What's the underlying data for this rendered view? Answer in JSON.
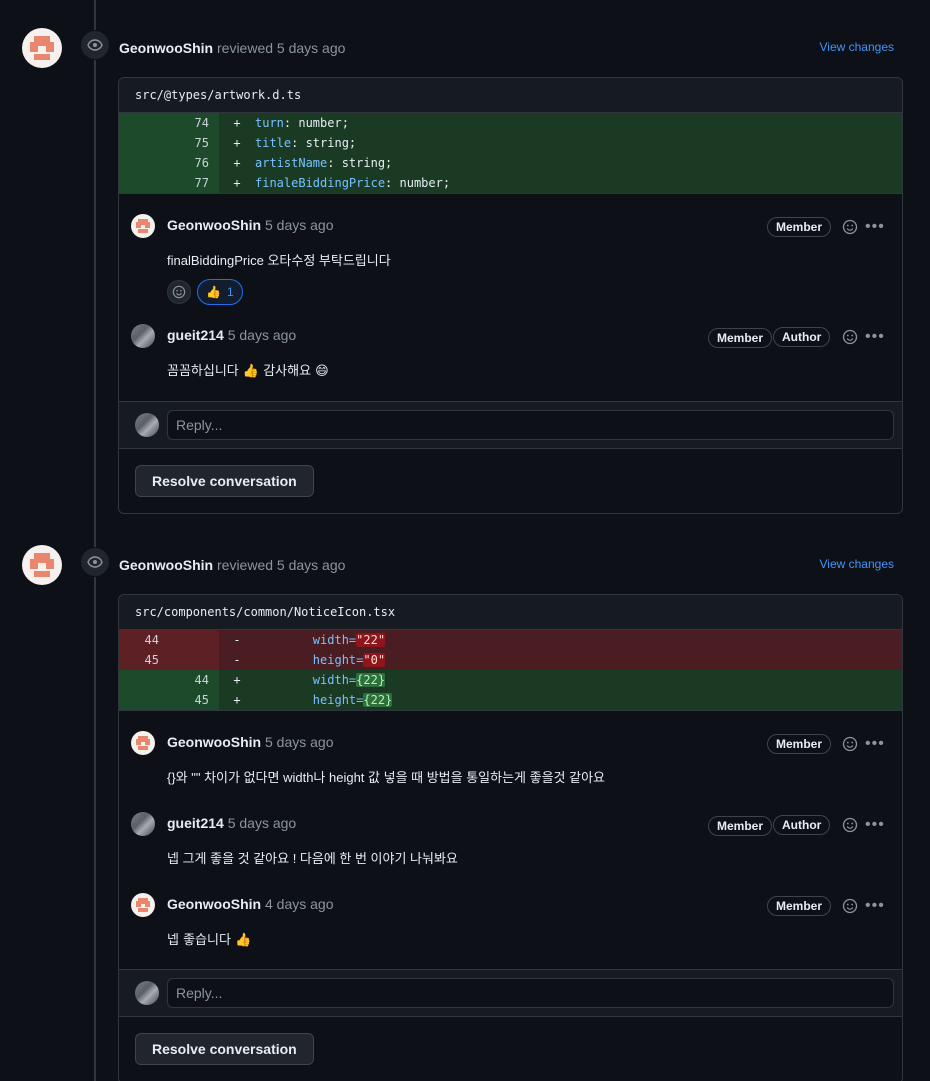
{
  "reviews": [
    {
      "reviewer": "GeonwooShin",
      "action": "reviewed",
      "time": "5 days ago",
      "view_changes": "View changes",
      "file_path": "src/@types/artwork.d.ts",
      "diff": [
        {
          "type": "add",
          "old": "",
          "new": "74",
          "sign": "+",
          "key": "turn",
          "rest": ": number;"
        },
        {
          "type": "add",
          "old": "",
          "new": "75",
          "sign": "+",
          "key": "title",
          "rest": ": string;"
        },
        {
          "type": "add",
          "old": "",
          "new": "76",
          "sign": "+",
          "key": "artistName",
          "rest": ": string;"
        },
        {
          "type": "add",
          "old": "",
          "new": "77",
          "sign": "+",
          "key": "finaleBiddingPrice",
          "rest": ": number;"
        }
      ],
      "comments": [
        {
          "author": "GeonwooShin",
          "time": "5 days ago",
          "labels": [
            "Member"
          ],
          "body": "finalBiddingPrice 오타수정 부탁드립니다",
          "reaction": {
            "emoji": "👍",
            "count": "1"
          }
        },
        {
          "author": "gueit214",
          "time": "5 days ago",
          "labels": [
            "Member",
            "Author"
          ],
          "body": "꼼꼼하십니다 👍 감사해요 😄"
        }
      ],
      "reply_placeholder": "Reply...",
      "resolve_label": "Resolve conversation"
    },
    {
      "reviewer": "GeonwooShin",
      "action": "reviewed",
      "time": "5 days ago",
      "view_changes": "View changes",
      "file_path": "src/components/common/NoticeIcon.tsx",
      "diff": [
        {
          "type": "del",
          "old": "44",
          "new": "",
          "sign": "-",
          "attr": "width=",
          "val": "\"22\""
        },
        {
          "type": "del",
          "old": "45",
          "new": "",
          "sign": "-",
          "attr": "height=",
          "val": "\"0\""
        },
        {
          "type": "add",
          "old": "",
          "new": "44",
          "sign": "+",
          "attr": "width=",
          "val": "{22}"
        },
        {
          "type": "add",
          "old": "",
          "new": "45",
          "sign": "+",
          "attr": "height=",
          "val": "{22}"
        }
      ],
      "comments": [
        {
          "author": "GeonwooShin",
          "time": "5 days ago",
          "labels": [
            "Member"
          ],
          "body": "{}와 \"\" 차이가 없다면 width나 height 값 넣을 때 방법을 통일하는게 좋을것 같아요"
        },
        {
          "author": "gueit214",
          "time": "5 days ago",
          "labels": [
            "Member",
            "Author"
          ],
          "body": "넵 그게 좋을 것 같아요 ! 다음에 한 번 이야기 나눠봐요"
        },
        {
          "author": "GeonwooShin",
          "time": "4 days ago",
          "labels": [
            "Member"
          ],
          "body": "넵 좋습니다 👍"
        }
      ],
      "reply_placeholder": "Reply...",
      "resolve_label": "Resolve conversation"
    }
  ],
  "colors": {
    "background": "#0d1117",
    "link": "#4493f8",
    "add_row": "#1a3a24",
    "del_row": "#4a1d22",
    "identicon": "#e8866e"
  },
  "icons": [
    "eye-icon",
    "smiley-icon",
    "kebab-horizontal-icon",
    "thumbs-up-icon"
  ]
}
